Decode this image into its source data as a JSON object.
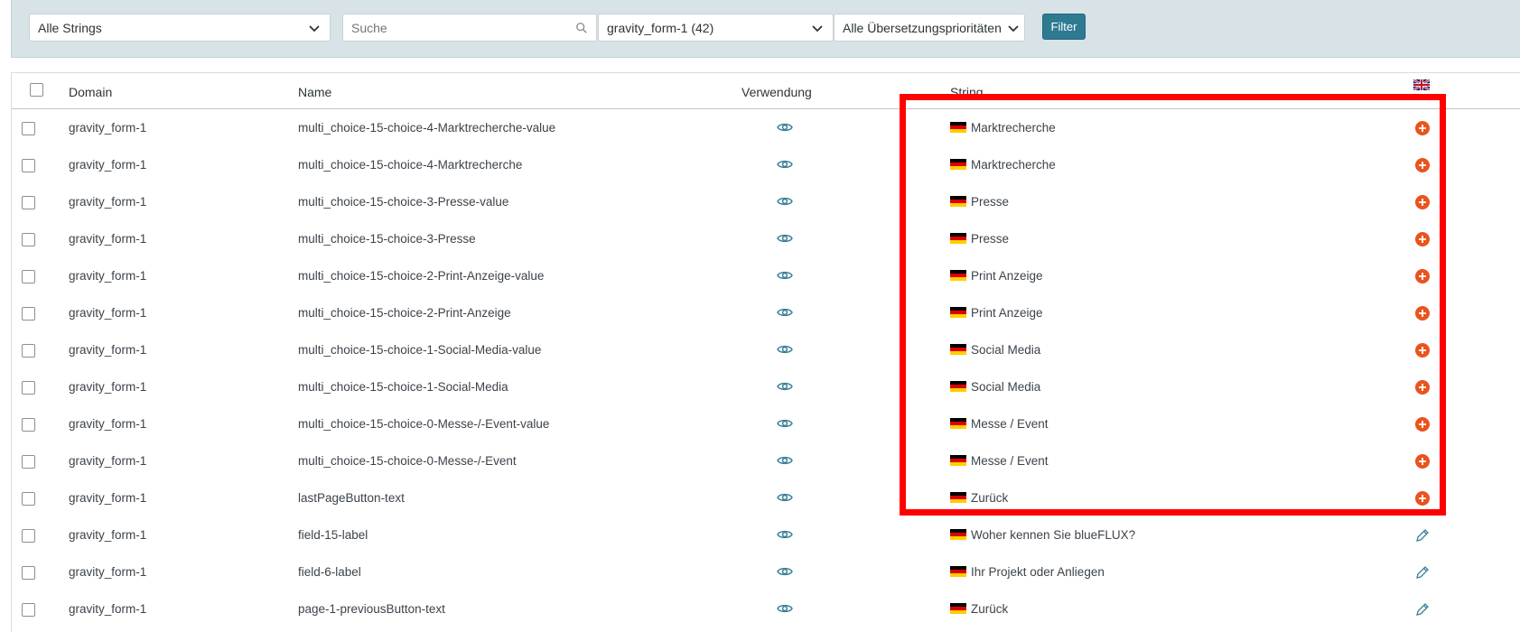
{
  "filters": {
    "type_select": "Alle Strings",
    "search_placeholder": "Suche",
    "domain_select": "gravity_form-1 (42)",
    "priority_select": "Alle Übersetzungsprioritäten",
    "filter_button": "Filter"
  },
  "table": {
    "headers": {
      "domain": "Domain",
      "name": "Name",
      "usage": "Verwendung",
      "string": "String",
      "target_language_icon": "uk-flag-icon"
    },
    "rows": [
      {
        "domain": "gravity_form-1",
        "name": "multi_choice-15-choice-4-Marktrecherche-value",
        "string": "Marktrecherche",
        "action": "add-translation-icon"
      },
      {
        "domain": "gravity_form-1",
        "name": "multi_choice-15-choice-4-Marktrecherche",
        "string": "Marktrecherche",
        "action": "add-translation-icon"
      },
      {
        "domain": "gravity_form-1",
        "name": "multi_choice-15-choice-3-Presse-value",
        "string": "Presse",
        "action": "add-translation-icon"
      },
      {
        "domain": "gravity_form-1",
        "name": "multi_choice-15-choice-3-Presse",
        "string": "Presse",
        "action": "add-translation-icon"
      },
      {
        "domain": "gravity_form-1",
        "name": "multi_choice-15-choice-2-Print-Anzeige-value",
        "string": "Print Anzeige",
        "action": "add-translation-icon"
      },
      {
        "domain": "gravity_form-1",
        "name": "multi_choice-15-choice-2-Print-Anzeige",
        "string": "Print Anzeige",
        "action": "add-translation-icon"
      },
      {
        "domain": "gravity_form-1",
        "name": "multi_choice-15-choice-1-Social-Media-value",
        "string": "Social Media",
        "action": "add-translation-icon"
      },
      {
        "domain": "gravity_form-1",
        "name": "multi_choice-15-choice-1-Social-Media",
        "string": "Social Media",
        "action": "add-translation-icon"
      },
      {
        "domain": "gravity_form-1",
        "name": "multi_choice-15-choice-0-Messe-/-Event-value",
        "string": "Messe / Event",
        "action": "add-translation-icon"
      },
      {
        "domain": "gravity_form-1",
        "name": "multi_choice-15-choice-0-Messe-/-Event",
        "string": "Messe / Event",
        "action": "add-translation-icon"
      },
      {
        "domain": "gravity_form-1",
        "name": "lastPageButton-text",
        "string": "Zurück",
        "action": "add-translation-icon"
      },
      {
        "domain": "gravity_form-1",
        "name": "field-15-label",
        "string": "Woher kennen Sie blueFLUX?",
        "action": "edit-translation-icon"
      },
      {
        "domain": "gravity_form-1",
        "name": "field-6-label",
        "string": "Ihr Projekt oder Anliegen",
        "action": "edit-translation-icon"
      },
      {
        "domain": "gravity_form-1",
        "name": "page-1-previousButton-text",
        "string": "Zurück",
        "action": "edit-translation-icon"
      }
    ]
  },
  "colors": {
    "filterbar_bg": "#d7e3e7",
    "filter_button": "#2d7a91",
    "add_icon": "#e9541e",
    "eye_icon": "#3a7f97",
    "highlight": "#ff0000"
  }
}
